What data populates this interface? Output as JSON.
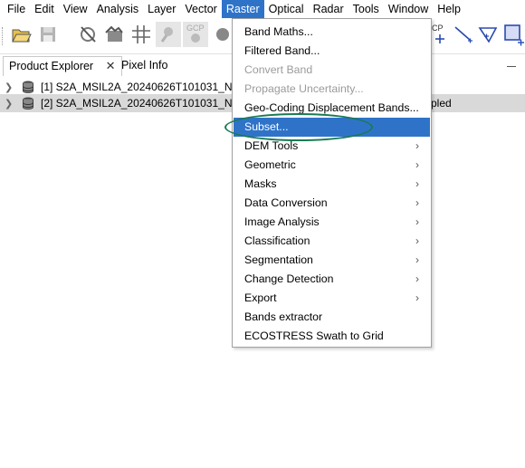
{
  "menubar": {
    "items": [
      {
        "label": "File"
      },
      {
        "label": "Edit"
      },
      {
        "label": "View"
      },
      {
        "label": "Analysis"
      },
      {
        "label": "Layer"
      },
      {
        "label": "Vector"
      },
      {
        "label": "Raster"
      },
      {
        "label": "Optical"
      },
      {
        "label": "Radar"
      },
      {
        "label": "Tools"
      },
      {
        "label": "Window"
      },
      {
        "label": "Help"
      }
    ],
    "active": "Raster"
  },
  "toolbar": {
    "gcp_label": "GCP",
    "gcp_label_right": "CP",
    "icons": [
      "open-product-icon",
      "save-product-icon",
      "no-data-mask-icon",
      "layer-manager-icon",
      "graticule-icon",
      "pin-manager-icon",
      "gcp-manager-icon",
      "cursor-sync-icon",
      "line-draw-icon",
      "polygon-draw-icon",
      "rectangle-draw-icon"
    ]
  },
  "panel": {
    "tabs": [
      {
        "label": "Product Explorer",
        "active": true,
        "close": "✕"
      },
      {
        "label": "Pixel Info",
        "active": false
      }
    ]
  },
  "tree": {
    "products": [
      {
        "label": "[1] S2A_MSIL2A_20240626T101031_N051",
        "tail": ""
      },
      {
        "label": "[2] S2A_MSIL2A_20240626T101031_N051",
        "tail": "pled"
      }
    ]
  },
  "raster_menu": {
    "items": [
      {
        "label": "Band Maths...",
        "submenu": false,
        "disabled": false
      },
      {
        "label": "Filtered Band...",
        "submenu": false,
        "disabled": false
      },
      {
        "label": "Convert Band",
        "submenu": false,
        "disabled": true
      },
      {
        "label": "Propagate Uncertainty...",
        "submenu": false,
        "disabled": true
      },
      {
        "label": "Geo-Coding Displacement Bands...",
        "submenu": false,
        "disabled": false
      },
      {
        "label": "Subset...",
        "submenu": false,
        "disabled": false,
        "highlighted": true
      },
      {
        "label": "DEM Tools",
        "submenu": true,
        "disabled": false
      },
      {
        "label": "Geometric",
        "submenu": true,
        "disabled": false
      },
      {
        "label": "Masks",
        "submenu": true,
        "disabled": false
      },
      {
        "label": "Data Conversion",
        "submenu": true,
        "disabled": false
      },
      {
        "label": "Image Analysis",
        "submenu": true,
        "disabled": false
      },
      {
        "label": "Classification",
        "submenu": true,
        "disabled": false
      },
      {
        "label": "Segmentation",
        "submenu": true,
        "disabled": false
      },
      {
        "label": "Change Detection",
        "submenu": true,
        "disabled": false
      },
      {
        "label": "Export",
        "submenu": true,
        "disabled": false
      },
      {
        "label": "Bands extractor",
        "submenu": false,
        "disabled": false
      },
      {
        "label": "ECOSTRESS Swath to Grid",
        "submenu": false,
        "disabled": false
      }
    ],
    "submenu_arrow": "›",
    "highlight_color": "#2f73c9",
    "annotation_color": "#1a7a55"
  }
}
